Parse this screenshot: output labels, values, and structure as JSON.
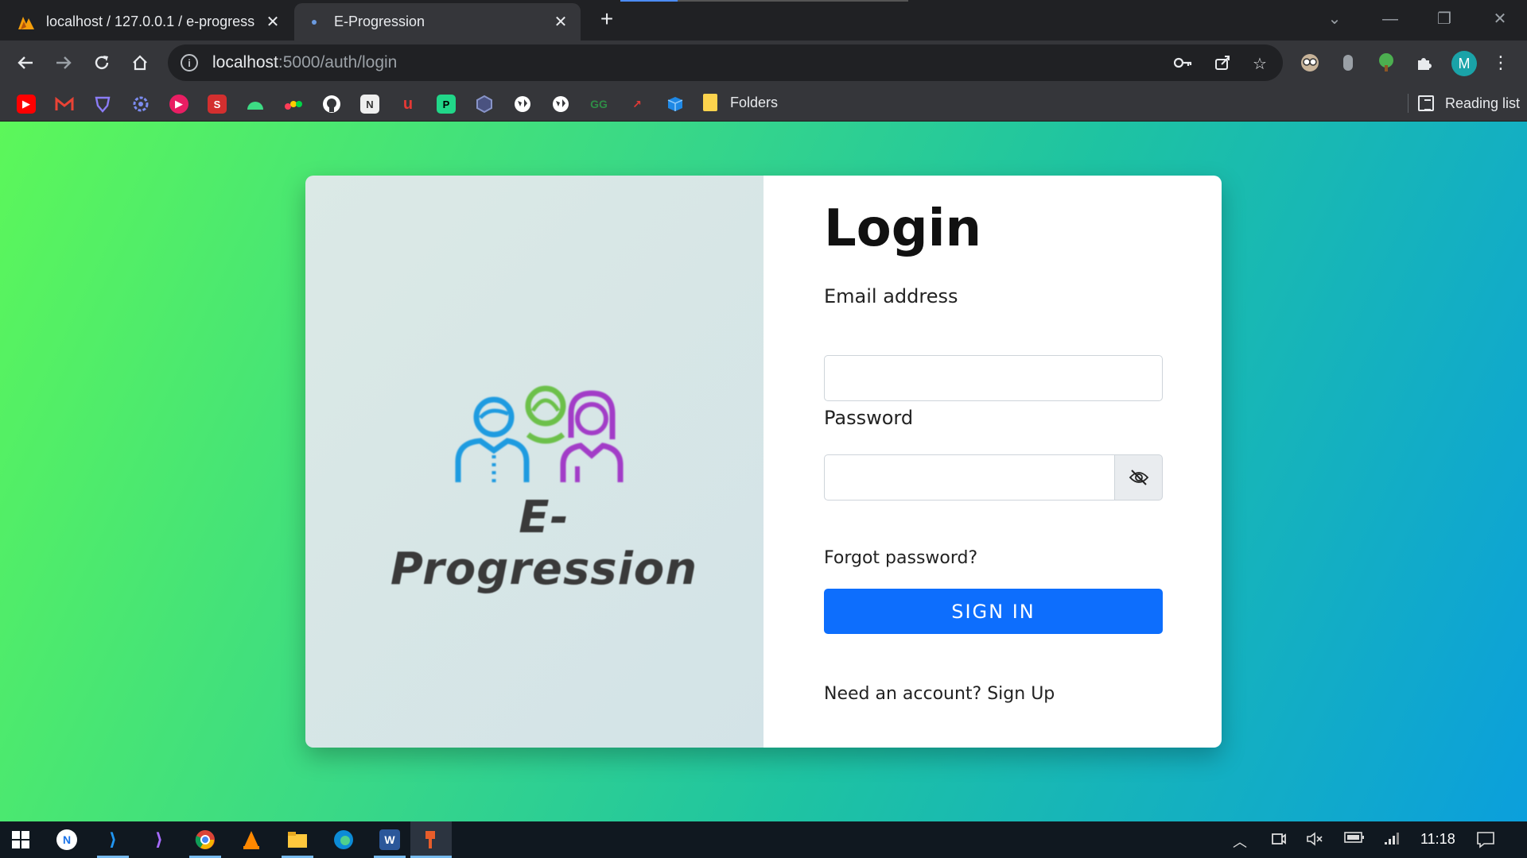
{
  "browser": {
    "tabs": [
      {
        "title": "localhost / 127.0.0.1 / e-progress",
        "active": false
      },
      {
        "title": "E-Progression",
        "active": true
      }
    ],
    "url_host": "localhost",
    "url_path": ":5000/auth/login",
    "profile_initial": "M",
    "bookmarks_folder": "Folders",
    "reading_list": "Reading list"
  },
  "login": {
    "title": "Login",
    "email_label": "Email address",
    "email_value": "",
    "password_label": "Password",
    "password_value": "",
    "forgot_link": "Forgot password?",
    "submit_button": "SIGN IN",
    "signup_prompt": "Need an account? Sign Up"
  },
  "brand": {
    "logo_text": "E-Progression",
    "colors": {
      "figure_blue": "#1e9be0",
      "figure_green": "#6cc04a",
      "figure_purple": "#a23cc7",
      "primary": "#0d6efd"
    }
  },
  "taskbar": {
    "clock": "11:18"
  }
}
